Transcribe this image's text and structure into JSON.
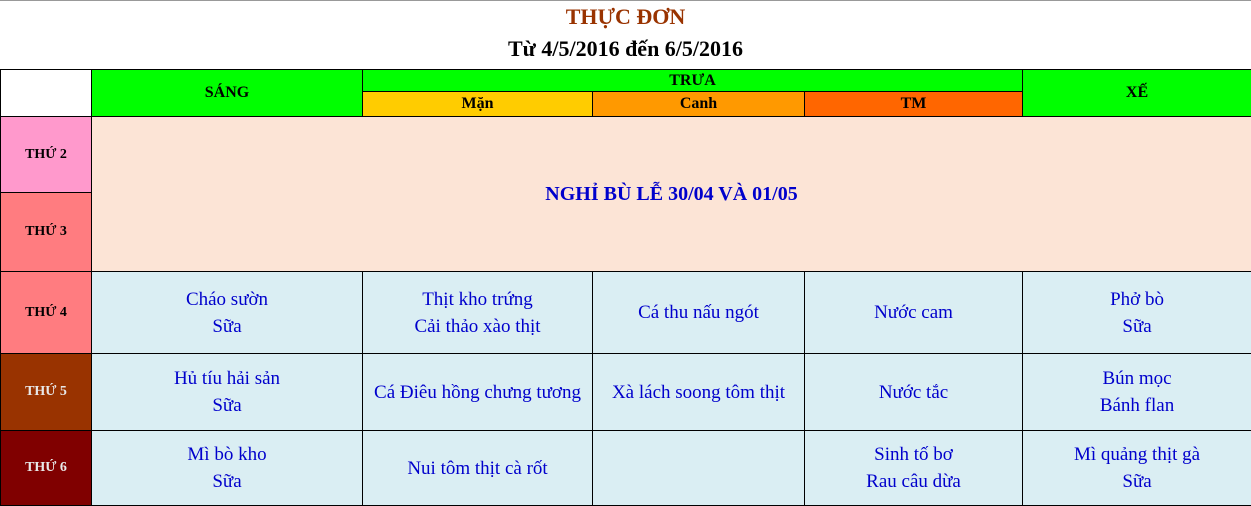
{
  "header": {
    "title": "THỰC ĐƠN",
    "subtitle": "Từ  4/5/2016 đến 6/5/2016"
  },
  "columns": {
    "sang": "SÁNG",
    "trua": "TRƯA",
    "man": "Mặn",
    "canh": "Canh",
    "tm": "TM",
    "xe": "XẾ"
  },
  "colors": {
    "green": "#00ff00",
    "man": "#ffcc00",
    "canh": "#ff9900",
    "tm": "#ff6600",
    "thu2": "#ff99cc",
    "thu3": "#ff7c80",
    "thu4": "#ff7c80",
    "thu5": "#993300",
    "thu6": "#800000",
    "holiday": "#fce4d6",
    "cell": "#daeef3",
    "text_blue": "#0000cc",
    "title": "#993300"
  },
  "days": {
    "thu2": "THỨ 2",
    "thu3": "THỨ 3",
    "thu4": "THỨ 4",
    "thu5": "THỨ 5",
    "thu6": "THỨ 6"
  },
  "holiday": "NGHỈ BÙ LỄ 30/04 VÀ 01/05",
  "meals": {
    "thu4": {
      "sang": [
        "Cháo sườn",
        "Sữa"
      ],
      "man": [
        "Thịt  kho trứng",
        "Cải thảo xào thịt"
      ],
      "canh": "Cá thu nấu ngót",
      "tm": "Nước cam",
      "xe": [
        "Phở bò",
        "Sữa"
      ]
    },
    "thu5": {
      "sang": [
        "Hủ tíu hải sản",
        "Sữa"
      ],
      "man": "Cá Điêu hồng chưng tương",
      "canh": "Xà lách soong tôm thịt",
      "tm": "Nước tắc",
      "xe": [
        "Bún mọc",
        "Bánh flan"
      ]
    },
    "thu6": {
      "sang": [
        "Mì bò kho",
        "Sữa"
      ],
      "man": "Nui tôm thịt cà rốt",
      "canh": "",
      "tm": [
        "Sinh tố bơ",
        "Rau câu dừa"
      ],
      "xe": [
        "Mì quảng thịt gà",
        "Sữa"
      ]
    }
  }
}
